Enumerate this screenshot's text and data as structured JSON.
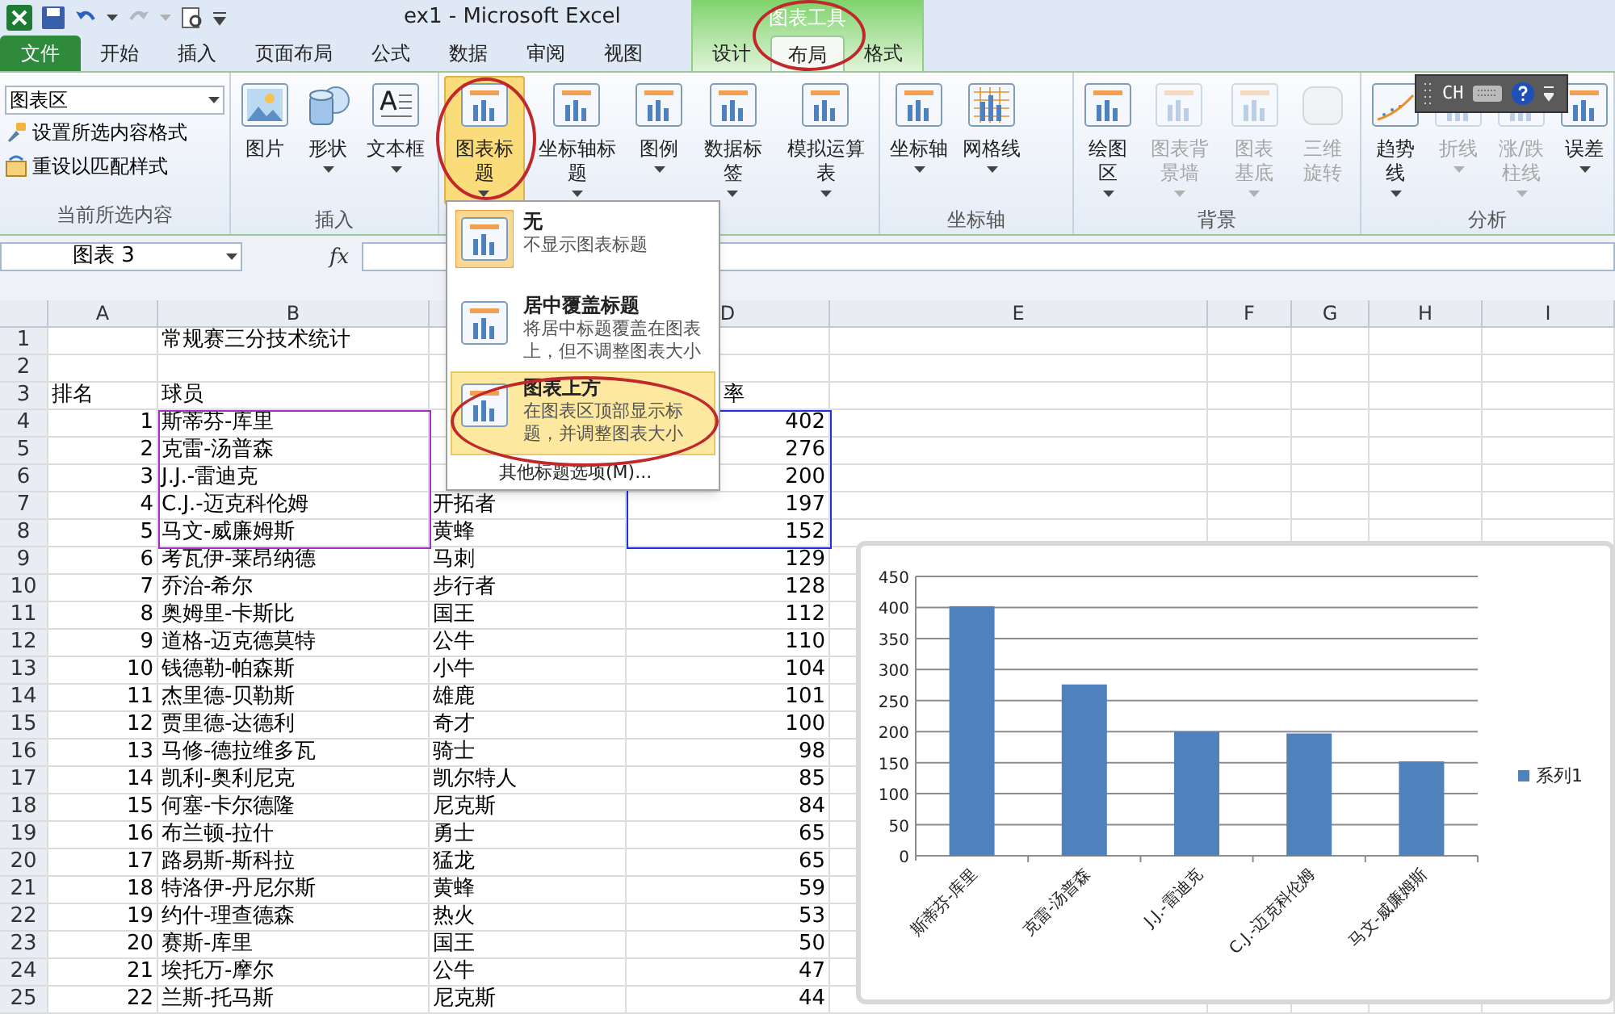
{
  "title_bar": {
    "title": "ex1  -  Microsoft Excel",
    "context_label": "图表工具"
  },
  "tabs": [
    {
      "label": "文件",
      "kind": "file",
      "selected": false
    },
    {
      "label": "开始",
      "kind": "normal",
      "selected": false
    },
    {
      "label": "插入",
      "kind": "normal",
      "selected": false
    },
    {
      "label": "页面布局",
      "kind": "normal",
      "selected": false
    },
    {
      "label": "公式",
      "kind": "normal",
      "selected": false
    },
    {
      "label": "数据",
      "kind": "normal",
      "selected": false
    },
    {
      "label": "审阅",
      "kind": "normal",
      "selected": false
    },
    {
      "label": "视图",
      "kind": "normal",
      "selected": false
    },
    {
      "label": "设计",
      "kind": "context",
      "selected": false
    },
    {
      "label": "布局",
      "kind": "context",
      "selected": true
    },
    {
      "label": "格式",
      "kind": "context",
      "selected": false
    }
  ],
  "ribbon": {
    "selection_group": {
      "label": "当前所选内容",
      "dropdown": "图表区",
      "commands": [
        {
          "label": "设置所选内容格式"
        },
        {
          "label": "重设以匹配样式"
        }
      ]
    },
    "groups": [
      {
        "label": "插入",
        "buttons": [
          {
            "label": "图片",
            "menu": false,
            "disabled": false,
            "pressed": false
          },
          {
            "label": "形状",
            "menu": true,
            "disabled": false,
            "pressed": false
          },
          {
            "label": "文本框",
            "menu": true,
            "disabled": false,
            "pressed": false
          }
        ]
      },
      {
        "buttons": [
          {
            "label": "图表标题",
            "menu": true,
            "disabled": false,
            "pressed": true
          },
          {
            "label": "坐标轴标题",
            "menu": true,
            "disabled": false,
            "pressed": false
          },
          {
            "label": "图例",
            "menu": true,
            "disabled": false,
            "pressed": false
          },
          {
            "label": "数据标签",
            "menu": true,
            "disabled": false,
            "pressed": false
          },
          {
            "label": "模拟运算表",
            "menu": true,
            "disabled": false,
            "pressed": false
          }
        ]
      },
      {
        "label": "坐标轴",
        "buttons": [
          {
            "label": "坐标轴",
            "menu": true,
            "disabled": false,
            "pressed": false
          },
          {
            "label": "网格线",
            "menu": true,
            "disabled": false,
            "pressed": false
          }
        ]
      },
      {
        "label": "背景",
        "buttons": [
          {
            "label": "绘图区",
            "menu": true,
            "disabled": false,
            "pressed": false
          },
          {
            "label": "图表背景墙",
            "menu": true,
            "disabled": true,
            "pressed": false
          },
          {
            "label": "图表基底",
            "menu": true,
            "disabled": true,
            "pressed": false
          },
          {
            "label": "三维旋转",
            "menu": false,
            "disabled": true,
            "pressed": false
          }
        ]
      },
      {
        "label": "分析",
        "buttons": [
          {
            "label": "趋势线",
            "menu": true,
            "disabled": false,
            "pressed": false
          },
          {
            "label": "折线",
            "menu": true,
            "disabled": true,
            "pressed": false
          },
          {
            "label": "涨/跌柱线",
            "menu": true,
            "disabled": true,
            "pressed": false
          },
          {
            "label": "误差",
            "menu": true,
            "disabled": false,
            "pressed": false
          }
        ]
      }
    ]
  },
  "language_bar": {
    "language": "CH"
  },
  "formula_bar": {
    "name_box": "图表 3",
    "function_label": "fx"
  },
  "title_menu": {
    "items": [
      {
        "title": "无",
        "description": "不显示图表标题",
        "current": true,
        "selected": false
      },
      {
        "title": "居中覆盖标题",
        "description": "将居中标题覆盖在图表上，但不调整图表大小",
        "current": false,
        "selected": false
      },
      {
        "title": "图表上方",
        "description": "在图表区顶部显示标题，并调整图表大小",
        "current": false,
        "selected": true
      }
    ],
    "more": "其他标题选项(M)..."
  },
  "sheet": {
    "columns": [
      {
        "label": "A"
      },
      {
        "label": "B"
      },
      {},
      {
        "label": "D"
      },
      {
        "label": "E"
      },
      {
        "label": "F"
      },
      {
        "label": "G"
      },
      {
        "label": "H"
      },
      {
        "label": "I"
      }
    ],
    "rows": [
      {
        "number": "1",
        "kind": "title",
        "player": "常规赛三分技术统计"
      },
      {
        "number": "2",
        "kind": "blank"
      },
      {
        "number": "3",
        "kind": "header",
        "rank": "排名",
        "player": "球员",
        "value": "率"
      },
      {
        "number": "4",
        "kind": "data",
        "rank": "1",
        "player": "斯蒂芬-库里",
        "value": "402"
      },
      {
        "number": "5",
        "kind": "data",
        "rank": "2",
        "player": "克雷-汤普森",
        "value": "276"
      },
      {
        "number": "6",
        "kind": "data",
        "rank": "3",
        "player": "J.J.-雷迪克",
        "value": "200"
      },
      {
        "number": "7",
        "kind": "data",
        "rank": "4",
        "player": "C.J.-迈克科伦姆",
        "team": "开拓者",
        "value": "197"
      },
      {
        "number": "8",
        "kind": "data",
        "rank": "5",
        "player": "马文-威廉姆斯",
        "team": "黄蜂",
        "value": "152"
      },
      {
        "number": "9",
        "kind": "data",
        "rank": "6",
        "player": "考瓦伊-莱昂纳德",
        "team": "马刺",
        "value": "129"
      },
      {
        "number": "10",
        "kind": "data",
        "rank": "7",
        "player": "乔治-希尔",
        "team": "步行者",
        "value": "128"
      },
      {
        "number": "11",
        "kind": "data",
        "rank": "8",
        "player": "奥姆里-卡斯比",
        "team": "国王",
        "value": "112"
      },
      {
        "number": "12",
        "kind": "data",
        "rank": "9",
        "player": "道格-迈克德莫特",
        "team": "公牛",
        "value": "110"
      },
      {
        "number": "13",
        "kind": "data",
        "rank": "10",
        "player": "钱德勒-帕森斯",
        "team": "小牛",
        "value": "104"
      },
      {
        "number": "14",
        "kind": "data",
        "rank": "11",
        "player": "杰里德-贝勒斯",
        "team": "雄鹿",
        "value": "101"
      },
      {
        "number": "15",
        "kind": "data",
        "rank": "12",
        "player": "贾里德-达德利",
        "team": "奇才",
        "value": "100"
      },
      {
        "number": "16",
        "kind": "data",
        "rank": "13",
        "player": "马修-德拉维多瓦",
        "team": "骑士",
        "value": "98"
      },
      {
        "number": "17",
        "kind": "data",
        "rank": "14",
        "player": "凯利-奥利尼克",
        "team": "凯尔特人",
        "value": "85"
      },
      {
        "number": "18",
        "kind": "data",
        "rank": "15",
        "player": "何塞-卡尔德隆",
        "team": "尼克斯",
        "value": "84"
      },
      {
        "number": "19",
        "kind": "data",
        "rank": "16",
        "player": "布兰顿-拉什",
        "team": "勇士",
        "value": "65"
      },
      {
        "number": "20",
        "kind": "data",
        "rank": "17",
        "player": "路易斯-斯科拉",
        "team": "猛龙",
        "value": "65"
      },
      {
        "number": "21",
        "kind": "data",
        "rank": "18",
        "player": "特洛伊-丹尼尔斯",
        "team": "黄蜂",
        "value": "59"
      },
      {
        "number": "22",
        "kind": "data",
        "rank": "19",
        "player": "约什-理查德森",
        "team": "热火",
        "value": "53"
      },
      {
        "number": "23",
        "kind": "data",
        "rank": "20",
        "player": "赛斯-库里",
        "team": "国王",
        "value": "50"
      },
      {
        "number": "24",
        "kind": "data",
        "rank": "21",
        "player": "埃托万-摩尔",
        "team": "公牛",
        "value": "47"
      },
      {
        "number": "25",
        "kind": "data",
        "rank": "22",
        "player": "兰斯-托马斯",
        "team": "尼克斯",
        "value": "44"
      }
    ]
  },
  "chart": {
    "chart_data": {
      "type": "bar",
      "categories": [
        "斯蒂芬-库里",
        "克雷-汤普森",
        "J.J.-雷迪克",
        "C.J.-迈克科伦姆",
        "马文-威廉姆斯"
      ],
      "series": [
        {
          "name": "系列1",
          "color": "#4f81bd",
          "values": [
            402,
            276,
            200,
            197,
            152
          ]
        }
      ],
      "ylim": [
        0,
        450
      ],
      "grid": true,
      "yticks": [
        0,
        50,
        100,
        150,
        200,
        250,
        300,
        350,
        400,
        450
      ]
    }
  }
}
